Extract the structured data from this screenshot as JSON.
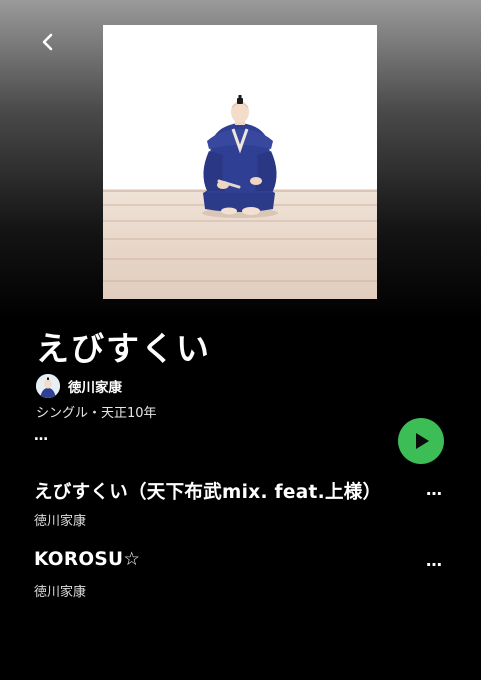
{
  "nav": {
    "back_icon": "chevron-left-icon"
  },
  "album": {
    "title": "えびすくい",
    "artist": "徳川家康",
    "meta": "シングル・天正10年",
    "more_label": "…",
    "cover_icon": "seated-samurai-artwork"
  },
  "play_button": {
    "icon": "play-icon",
    "color": "#3dbd55"
  },
  "tracks": [
    {
      "title": "えびすくい（天下布武mix. feat.上様）",
      "artist": "徳川家康",
      "more_label": "…"
    },
    {
      "title": "KOROSU☆",
      "artist": "徳川家康",
      "more_label": "…"
    }
  ]
}
